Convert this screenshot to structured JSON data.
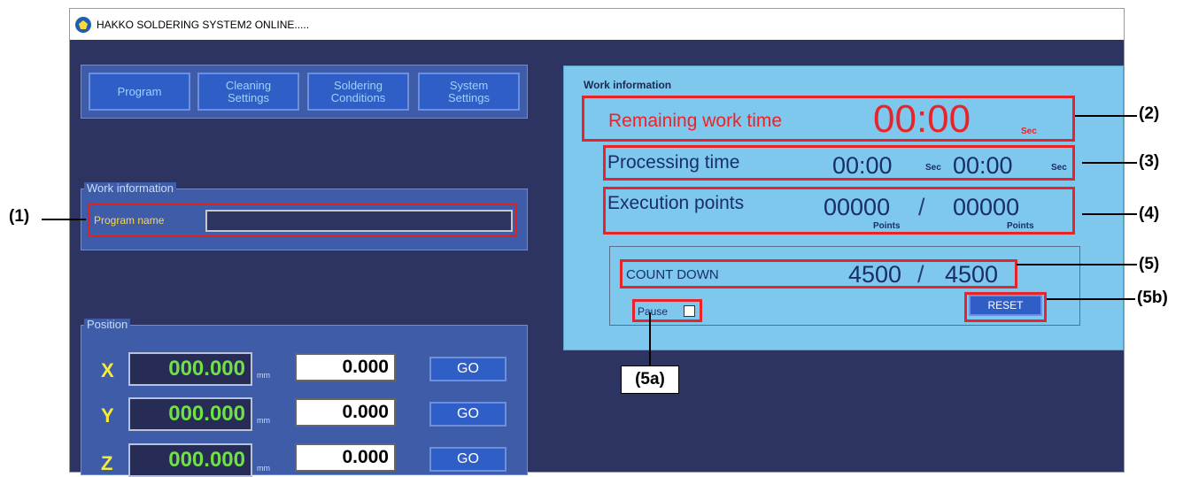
{
  "window": {
    "title": "HAKKO SOLDERING SYSTEM2 ONLINE....."
  },
  "top_buttons": [
    "Program",
    "Cleaning\nSettings",
    "Soldering\nConditions",
    "System\nSettings"
  ],
  "left_work_info": {
    "group_label": "Work information",
    "program_name_label": "Program name",
    "program_name_value": ""
  },
  "position": {
    "group_label": "Position",
    "unit": "mm",
    "go_label": "GO",
    "axes": [
      {
        "axis": "X",
        "current": "000.000",
        "target": "0.000"
      },
      {
        "axis": "Y",
        "current": "000.000",
        "target": "0.000"
      },
      {
        "axis": "Z",
        "current": "000.000",
        "target": "0.000"
      }
    ]
  },
  "right_work_info": {
    "title": "Work information",
    "remaining_label": "Remaining work time",
    "remaining_value": "00:00",
    "remaining_unit": "Sec",
    "processing_label": "Processing time",
    "processing_value_1": "00:00",
    "processing_unit_1": "Sec",
    "processing_value_2": "00:00",
    "processing_unit_2": "Sec",
    "execution_label": "Execution points",
    "execution_done": "00000",
    "execution_sep": "/",
    "execution_total": "00000",
    "points_unit": "Points",
    "countdown_label": "COUNT DOWN",
    "countdown_current": "4500",
    "countdown_sep": "/",
    "countdown_total": "4500",
    "pause_label": "Pause",
    "pause_checked": false,
    "reset_label": "RESET"
  },
  "callouts": {
    "c1": "(1)",
    "c2": "(2)",
    "c3": "(3)",
    "c4": "(4)",
    "c5": "(5)",
    "c5a": "(5a)",
    "c5b": "(5b)"
  }
}
